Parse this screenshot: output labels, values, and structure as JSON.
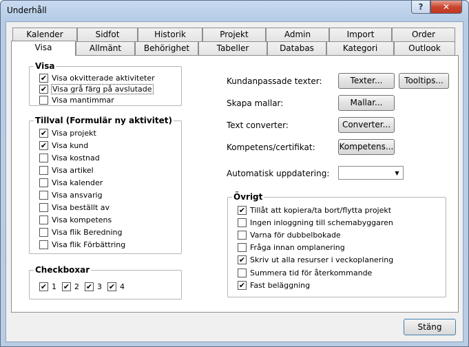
{
  "window": {
    "title": "Underhåll",
    "help_glyph": "?",
    "close_glyph": "✕"
  },
  "tabs": {
    "row1": [
      "Kalender",
      "Sidfot",
      "Historik",
      "Projekt",
      "Admin",
      "Import",
      "Order"
    ],
    "row2": [
      "Visa",
      "Allmänt",
      "Behörighet",
      "Tabeller",
      "Databas",
      "Kategori",
      "Outlook"
    ],
    "active": "Visa"
  },
  "visa_group": {
    "title": "Visa",
    "items": [
      {
        "label": "Visa okvitterade aktiviteter",
        "checked": true
      },
      {
        "label": "Visa grå färg på avslutade",
        "checked": true
      },
      {
        "label": "Visa mantimmar",
        "checked": false
      }
    ]
  },
  "tillval_group": {
    "title": "Tillval (Formulär ny aktivitet)",
    "items": [
      {
        "label": "Visa projekt",
        "checked": true
      },
      {
        "label": "Visa kund",
        "checked": true
      },
      {
        "label": "Visa kostnad",
        "checked": false
      },
      {
        "label": "Visa artikel",
        "checked": false
      },
      {
        "label": "Visa kalender",
        "checked": false
      },
      {
        "label": "Visa ansvarig",
        "checked": false
      },
      {
        "label": "Visa beställt av",
        "checked": false
      },
      {
        "label": "Visa kompetens",
        "checked": false
      },
      {
        "label": "Visa flik Beredning",
        "checked": false
      },
      {
        "label": "Visa flik Förbättring",
        "checked": false
      }
    ]
  },
  "checkboxar_group": {
    "title": "Checkboxar",
    "items": [
      {
        "label": "1",
        "checked": true
      },
      {
        "label": "2",
        "checked": true
      },
      {
        "label": "3",
        "checked": true
      },
      {
        "label": "4",
        "checked": true
      }
    ]
  },
  "right": {
    "kundanpassade_label": "Kundanpassade texter:",
    "texter_button": "Texter...",
    "tooltips_button": "Tooltips...",
    "mallar_label": "Skapa mallar:",
    "mallar_button": "Mallar...",
    "converter_label": "Text converter:",
    "converter_button": "Converter...",
    "kompetens_label": "Kompetens/certifikat:",
    "kompetens_button": "Kompetens...",
    "auto_label": "Automatisk uppdatering:",
    "auto_value": ""
  },
  "ovrigt_group": {
    "title": "Övrigt",
    "items": [
      {
        "label": "Tillåt att kopiera/ta bort/flytta projekt",
        "checked": true
      },
      {
        "label": "Ingen inloggning till schemabyggaren",
        "checked": false
      },
      {
        "label": "Varna för dubbelbokade",
        "checked": false
      },
      {
        "label": "Fråga innan omplanering",
        "checked": false
      },
      {
        "label": "Skriv ut alla resurser i veckoplanering",
        "checked": true
      },
      {
        "label": "Summera tid för återkommande",
        "checked": false
      },
      {
        "label": "Fast beläggning",
        "checked": true
      }
    ]
  },
  "footer": {
    "close_button": "Stäng"
  },
  "check_glyph": "✔"
}
